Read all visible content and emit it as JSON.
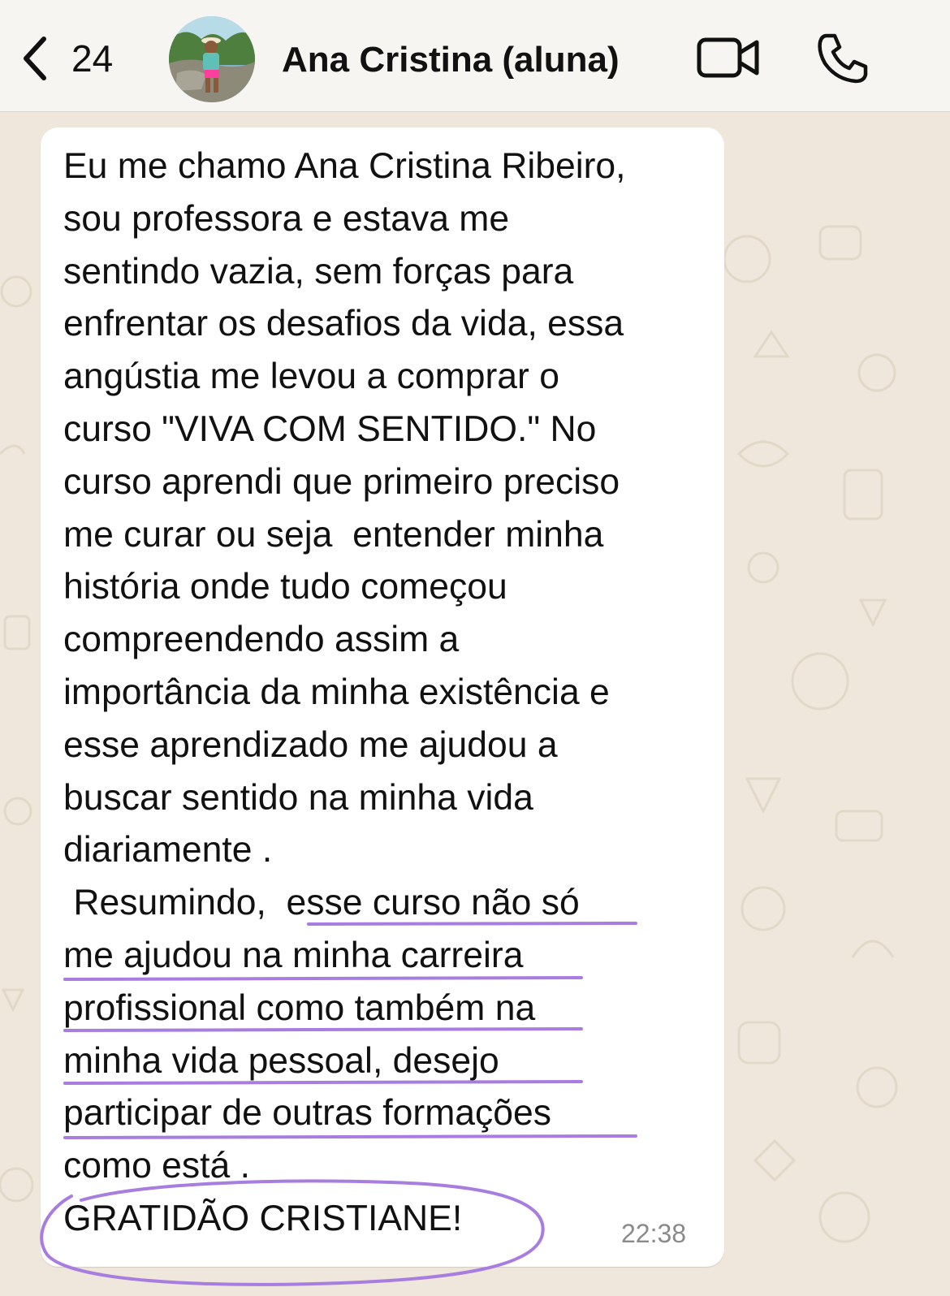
{
  "header": {
    "back_count": "24",
    "contact_name": "Ana Cristina (aluna)",
    "icons": [
      "chevron-left-icon",
      "video-camera-icon",
      "phone-icon"
    ]
  },
  "message": {
    "lines": [
      "Eu me chamo Ana Cristina Ribeiro,",
      "sou professora e estava me",
      "sentindo vazia, sem forças para",
      "enfrentar os desafios da vida, essa",
      "angústia me levou a comprar o",
      "curso \"VIVA COM SENTIDO.\" No",
      "curso aprendi que primeiro preciso",
      "me curar ou seja  entender minha",
      "história onde tudo começou",
      "compreendendo assim a",
      "importância da minha existência e",
      "esse aprendizado me ajudou a",
      "buscar sentido na minha vida",
      "diariamente .",
      " Resumindo,  esse curso não só",
      "me ajudou na minha carreira",
      "profissional como também na",
      "minha vida pessoal, desejo",
      "participar de outras formações",
      "como está .",
      "GRATIDÃO CRISTIANE!"
    ],
    "time": "22:38"
  },
  "colors": {
    "header_bg": "#f7f5f1",
    "chat_bg": "#efe7dc",
    "bubble_bg": "#ffffff",
    "highlight_ink": "#a77de0"
  }
}
